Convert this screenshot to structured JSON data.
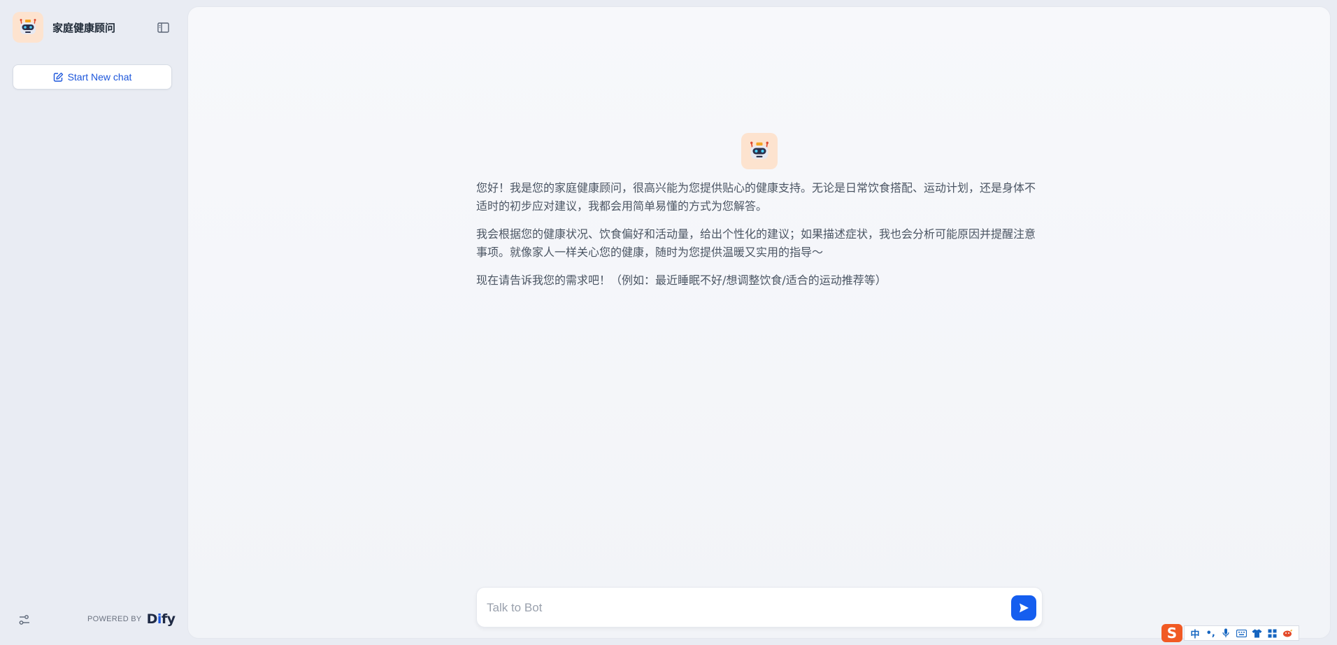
{
  "app": {
    "title": "家庭健康顾问"
  },
  "sidebar": {
    "new_chat_label": "Start New chat",
    "powered_by": "POWERED BY",
    "brand_prefix": "D",
    "brand_accent": "i",
    "brand_suffix": "fy"
  },
  "chat": {
    "intro_paragraphs": [
      "您好！我是您的家庭健康顾问，很高兴能为您提供贴心的健康支持。无论是日常饮食搭配、运动计划，还是身体不适时的初步应对建议，我都会用简单易懂的方式为您解答。",
      "我会根据您的健康状况、饮食偏好和活动量，给出个性化的建议；如果描述症状，我也会分析可能原因并提醒注意事项。就像家人一样关心您的健康，随时为您提供温暖又实用的指导～",
      "现在请告诉我您的需求吧！（例如：最近睡眠不好/想调整饮食/适合的运动推荐等）"
    ],
    "input_placeholder": "Talk to Bot"
  },
  "ime": {
    "logo": "S",
    "lang": "中",
    "punct": "•,"
  },
  "colors": {
    "accent": "#155eef",
    "link": "#1c56db",
    "avatar_bg": "#fde3cf",
    "sidebar_bg": "#e9ecf3"
  },
  "icons": {
    "bot_avatar": "robot-icon",
    "collapse": "sidebar-toggle-icon",
    "new_chat": "edit-icon",
    "settings": "sliders-icon",
    "send": "send-icon"
  }
}
